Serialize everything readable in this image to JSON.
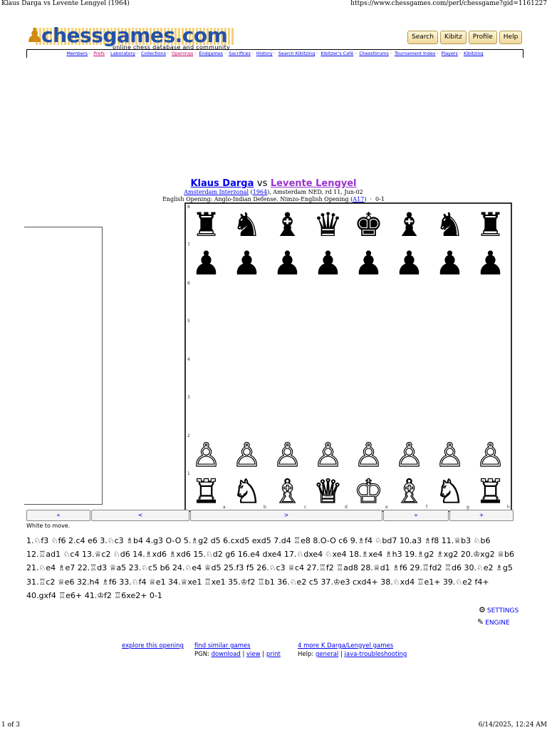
{
  "print_header": {
    "title": "Klaus Darga vs Levente Lengyel (1964)",
    "url": "https://www.chessgames.com/perl/chessgame?gid=1161227"
  },
  "print_footer": {
    "page": "1 of 3",
    "datetime": "6/14/2025, 12:24 AM"
  },
  "site": {
    "logo_text": "chessgames.com",
    "tagline": "online chess database and community",
    "top_buttons": [
      "Search",
      "Kibitz",
      "Profile",
      "Help"
    ],
    "nav_links": [
      "Members",
      "Prefs",
      "Laboratory",
      "Collections",
      "Openings",
      "Endgames",
      "Sacrifices",
      "History",
      "Search Kibitzing",
      "Kibitzer's Café",
      "Chessforums",
      "Tournament Index",
      "Players",
      "Kibitzing"
    ]
  },
  "game": {
    "white": "Klaus Darga",
    "vs": "vs",
    "black": "Levente Lengyel",
    "event": "Amsterdam Interzonal",
    "year": "1964",
    "place_round": ", Amsterdam NED, rd 11, Jun-02",
    "opening_label": "English Opening: Anglo-Indian Defense. Nimzo-English Opening",
    "eco": "A17",
    "result": "0-1",
    "to_move": "White to move."
  },
  "board": {
    "ranks": [
      "8",
      "7",
      "6",
      "5",
      "4",
      "3",
      "2",
      "1"
    ],
    "files": [
      "a",
      "b",
      "c",
      "d",
      "e",
      "f",
      "g",
      "h"
    ],
    "rank8": [
      "♜",
      "♞",
      "♝",
      "♛",
      "♚",
      "♝",
      "♞",
      "♜"
    ],
    "rank7": [
      "♟",
      "♟",
      "♟",
      "♟",
      "♟",
      "♟",
      "♟",
      "♟"
    ],
    "rank2": [
      "♙",
      "♙",
      "♙",
      "♙",
      "♙",
      "♙",
      "♙",
      "♙"
    ],
    "rank1": [
      "♖",
      "♘",
      "♗",
      "♕",
      "♔",
      "♗",
      "♘",
      "♖"
    ]
  },
  "nav_buttons": [
    "«",
    "<",
    ">",
    "»",
    "+"
  ],
  "moves_text": "1.♘f3 ♘f6 2.c4 e6 3.♘c3 ♗b4 4.g3 O-O 5.♗g2 d5 6.cxd5 exd5 7.d4 ♖e8 8.O-O c6 9.♗f4 ♘bd7 10.a3 ♗f8 11.♕b3 ♘b6 12.♖ad1 ♘c4 13.♕c2 ♘d6 14.♗xd6 ♗xd6 15.♘d2 g6 16.e4 dxe4 17.♘dxe4 ♘xe4 18.♗xe4 ♗h3 19.♗g2 ♗xg2 20.♔xg2 ♕b6 21.♘e4 ♗e7 22.♖d3 ♕a5 23.♘c5 b6 24.♘e4 ♕d5 25.f3 f5 26.♘c3 ♕c4 27.♖f2 ♖ad8 28.♕d1 ♗f6 29.♖fd2 ♖d6 30.♘e2 ♗g5 31.♖c2 ♕e6 32.h4 ♗f6 33.♘f4 ♕e1 34.♕xe1 ♖xe1 35.♔f2 ♖b1 36.♘e2 c5 37.♔e3 cxd4+ 38.♘xd4 ♖e1+ 39.♘e2 f4+ 40.gxf4 ♖e6+ 41.♔f2 ♖6xe2+ 0-1",
  "tools": {
    "settings_label": "SETTINGS",
    "engine_label": "ENGINE",
    "settings_icon": "gear-icon",
    "engine_icon": "edit-icon"
  },
  "footer_links": {
    "explore": "explore this opening",
    "similar": "find similar games",
    "more_games": "4 more K Darga/Lengyel games",
    "pgn_label": "PGN:",
    "download": "download",
    "view": "view",
    "print": "print",
    "help_label": "Help:",
    "general": "general",
    "java": "java-troubleshooting"
  }
}
